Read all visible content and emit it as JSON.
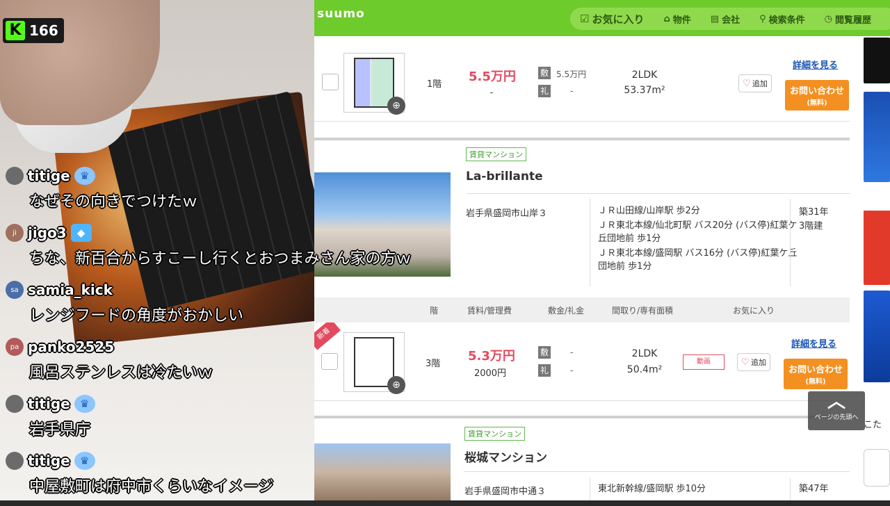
{
  "stream": {
    "viewer_count": "166",
    "logo_letter": "K"
  },
  "chat": [
    {
      "user": "titige",
      "text": "なぜその向きでつけたｗ",
      "avatar": "",
      "avatar_color": "#6b6b6b",
      "badge": "crown"
    },
    {
      "user": "jigo3",
      "text": "ちな、新百合からすこーし行くとおつまみさん家の方ｗ",
      "avatar": "ji",
      "avatar_color": "#a0705f",
      "badge": "cube"
    },
    {
      "user": "samia_kick",
      "text": "レンジフードの角度がおかしい",
      "avatar": "sa",
      "avatar_color": "#4a6ea8",
      "badge": ""
    },
    {
      "user": "panko2525",
      "text": "風呂ステンレスは冷たいｗ",
      "avatar": "pa",
      "avatar_color": "#b35a5a",
      "badge": ""
    },
    {
      "user": "titige",
      "text": "岩手県庁",
      "avatar": "",
      "avatar_color": "#6b6b6b",
      "badge": "crown"
    },
    {
      "user": "titige",
      "text": "中屋敷町は府中市くらいなイメージ",
      "avatar": "",
      "avatar_color": "#6b6b6b",
      "badge": "crown"
    }
  ],
  "header": {
    "logo": "suumo",
    "nav": [
      {
        "icon": "favorite-icon",
        "label": "お気に入り"
      },
      {
        "icon": "home-icon",
        "label": "物件"
      },
      {
        "icon": "building-icon",
        "label": "会社"
      },
      {
        "icon": "search-icon",
        "label": "検索条件"
      },
      {
        "icon": "history-icon",
        "label": "閲覧履歴"
      }
    ]
  },
  "listing1": {
    "floor": "1階",
    "rent": "5.5万円",
    "mgmt": "-",
    "deposit_label": "敷",
    "deposit": "5.5万円",
    "key_label": "礼",
    "key_money": "-",
    "layout": "2LDK",
    "area": "53.37m²",
    "fav": "追加",
    "detail": "詳細を見る",
    "contact1": "お問い合わせ",
    "contact2": "(無料)"
  },
  "building2": {
    "type": "賃貸マンション",
    "name": "La-brillante",
    "address": "岩手県盛岡市山岸３",
    "access": [
      "ＪＲ山田線/山岸駅 歩2分",
      "ＪＲ東北本線/仙北町駅 バス20分 (バス停)紅葉ケ丘団地前 歩1分",
      "ＪＲ東北本線/盛岡駅 バス16分 (バス停)紅葉ケ丘団地前 歩1分"
    ],
    "age": "築31年",
    "stories": "3階建"
  },
  "table_header": {
    "floor": "階",
    "rent": "賃料/管理費",
    "deposit": "敷金/礼金",
    "layout": "間取り/専有面積",
    "fav": "お気に入り"
  },
  "listing2": {
    "new": "新着",
    "floor": "3階",
    "rent": "5.3万円",
    "mgmt": "2000円",
    "deposit_label": "敷",
    "deposit": "-",
    "key_label": "礼",
    "key_money": "-",
    "layout": "2LDK",
    "area": "50.4m²",
    "video": "動画",
    "fav": "追加",
    "detail": "詳細を見る",
    "contact1": "お問い合わせ",
    "contact2": "(無料)"
  },
  "building3": {
    "type": "賃貸マンション",
    "name": "桜城マンション",
    "address": "岩手県盛岡市中通３",
    "access": "東北新幹線/盛岡駅 歩10分",
    "age": "築47年"
  },
  "page_top": {
    "label": "ページの先頭へ"
  },
  "side": {
    "partial": "こた"
  },
  "colors": {
    "brand": "#6ecb2c",
    "rent": "#e34a5e",
    "contact": "#f39021",
    "link": "#1a55b5",
    "kick": "#53fc18"
  }
}
